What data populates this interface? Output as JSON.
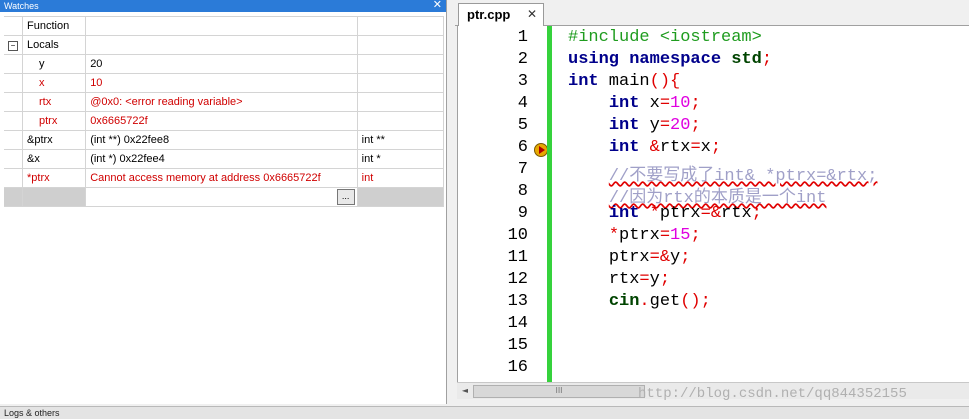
{
  "watches": {
    "title": "Watches",
    "close_glyph": "✕",
    "header_label": "Function",
    "locals_label": "Locals",
    "locals_expander": "−",
    "rows": [
      {
        "name": "y",
        "value": "20",
        "type": "",
        "error": false
      },
      {
        "name": "x",
        "value": "10",
        "type": "",
        "error": true
      },
      {
        "name": "rtx",
        "value": "@0x0: <error reading variable>",
        "type": "",
        "error": true
      },
      {
        "name": "ptrx",
        "value": "0x6665722f",
        "type": "",
        "error": true
      }
    ],
    "watch_rows": [
      {
        "name": "&ptrx",
        "value": "(int **) 0x22fee8",
        "type": "int **",
        "error": false
      },
      {
        "name": "&x",
        "value": "(int *) 0x22fee4",
        "type": "int *",
        "error": false
      },
      {
        "name": "*ptrx",
        "value": "Cannot access memory at address 0x6665722f",
        "type": "int",
        "error": true
      }
    ],
    "more_button": "..."
  },
  "bottom_bar": {
    "label": "Logs & others"
  },
  "editor": {
    "tab_label": "ptr.cpp",
    "tab_close": "✕",
    "breakpoint_line": 6,
    "line_numbers": [
      "1",
      "2",
      "3",
      "4",
      "5",
      "6",
      "7",
      "8",
      "9",
      "10",
      "11",
      "12",
      "13",
      "14",
      "15",
      "16"
    ],
    "lines": [
      [
        {
          "t": "#include <iostream>",
          "c": "pp"
        }
      ],
      [
        {
          "t": "using",
          "c": "kw"
        },
        {
          "t": " ",
          "c": ""
        },
        {
          "t": "namespace",
          "c": "kw"
        },
        {
          "t": " ",
          "c": ""
        },
        {
          "t": "std",
          "c": "std"
        },
        {
          "t": ";",
          "c": "op"
        }
      ],
      [
        {
          "t": "int",
          "c": "kw"
        },
        {
          "t": " main",
          "c": ""
        },
        {
          "t": "(){",
          "c": "op"
        }
      ],
      [
        {
          "t": "    ",
          "c": ""
        },
        {
          "t": "int",
          "c": "kw"
        },
        {
          "t": " x",
          "c": ""
        },
        {
          "t": "=",
          "c": "op"
        },
        {
          "t": "10",
          "c": "num"
        },
        {
          "t": ";",
          "c": "op"
        }
      ],
      [
        {
          "t": "    ",
          "c": ""
        },
        {
          "t": "int",
          "c": "kw"
        },
        {
          "t": " y",
          "c": ""
        },
        {
          "t": "=",
          "c": "op"
        },
        {
          "t": "20",
          "c": "num"
        },
        {
          "t": ";",
          "c": "op"
        }
      ],
      [
        {
          "t": "    ",
          "c": ""
        },
        {
          "t": "int",
          "c": "kw"
        },
        {
          "t": " ",
          "c": ""
        },
        {
          "t": "&",
          "c": "op"
        },
        {
          "t": "rtx",
          "c": ""
        },
        {
          "t": "=",
          "c": "op"
        },
        {
          "t": "x",
          "c": ""
        },
        {
          "t": ";",
          "c": "op"
        }
      ],
      [
        {
          "t": "    ",
          "c": ""
        },
        {
          "t": "//不要写成了int& *ptrx=&rtx;",
          "c": "cm cm-u"
        }
      ],
      [
        {
          "t": "    ",
          "c": ""
        },
        {
          "t": "//因为rtx的本质是一个int",
          "c": "cm cm-u"
        }
      ],
      [
        {
          "t": "    ",
          "c": ""
        },
        {
          "t": "int",
          "c": "kw"
        },
        {
          "t": " ",
          "c": ""
        },
        {
          "t": "*",
          "c": "op"
        },
        {
          "t": "ptrx",
          "c": ""
        },
        {
          "t": "=&",
          "c": "op"
        },
        {
          "t": "rtx",
          "c": ""
        },
        {
          "t": ";",
          "c": "op"
        }
      ],
      [
        {
          "t": "    ",
          "c": ""
        },
        {
          "t": "*",
          "c": "op"
        },
        {
          "t": "ptrx",
          "c": ""
        },
        {
          "t": "=",
          "c": "op"
        },
        {
          "t": "15",
          "c": "num"
        },
        {
          "t": ";",
          "c": "op"
        }
      ],
      [
        {
          "t": "    ",
          "c": ""
        },
        {
          "t": "ptrx",
          "c": ""
        },
        {
          "t": "=&",
          "c": "op"
        },
        {
          "t": "y",
          "c": ""
        },
        {
          "t": ";",
          "c": "op"
        }
      ],
      [
        {
          "t": "    ",
          "c": ""
        },
        {
          "t": "rtx",
          "c": ""
        },
        {
          "t": "=",
          "c": "op"
        },
        {
          "t": "y",
          "c": ""
        },
        {
          "t": ";",
          "c": "op"
        }
      ],
      [
        {
          "t": "    ",
          "c": ""
        },
        {
          "t": "cin",
          "c": "std"
        },
        {
          "t": ".",
          "c": "op"
        },
        {
          "t": "get",
          "c": ""
        },
        {
          "t": "();",
          "c": "op"
        }
      ],
      [],
      [],
      []
    ],
    "scroll_left": "◄",
    "scroll_thumb": "III"
  },
  "watermark": "http://blog.csdn.net/qq844352155"
}
